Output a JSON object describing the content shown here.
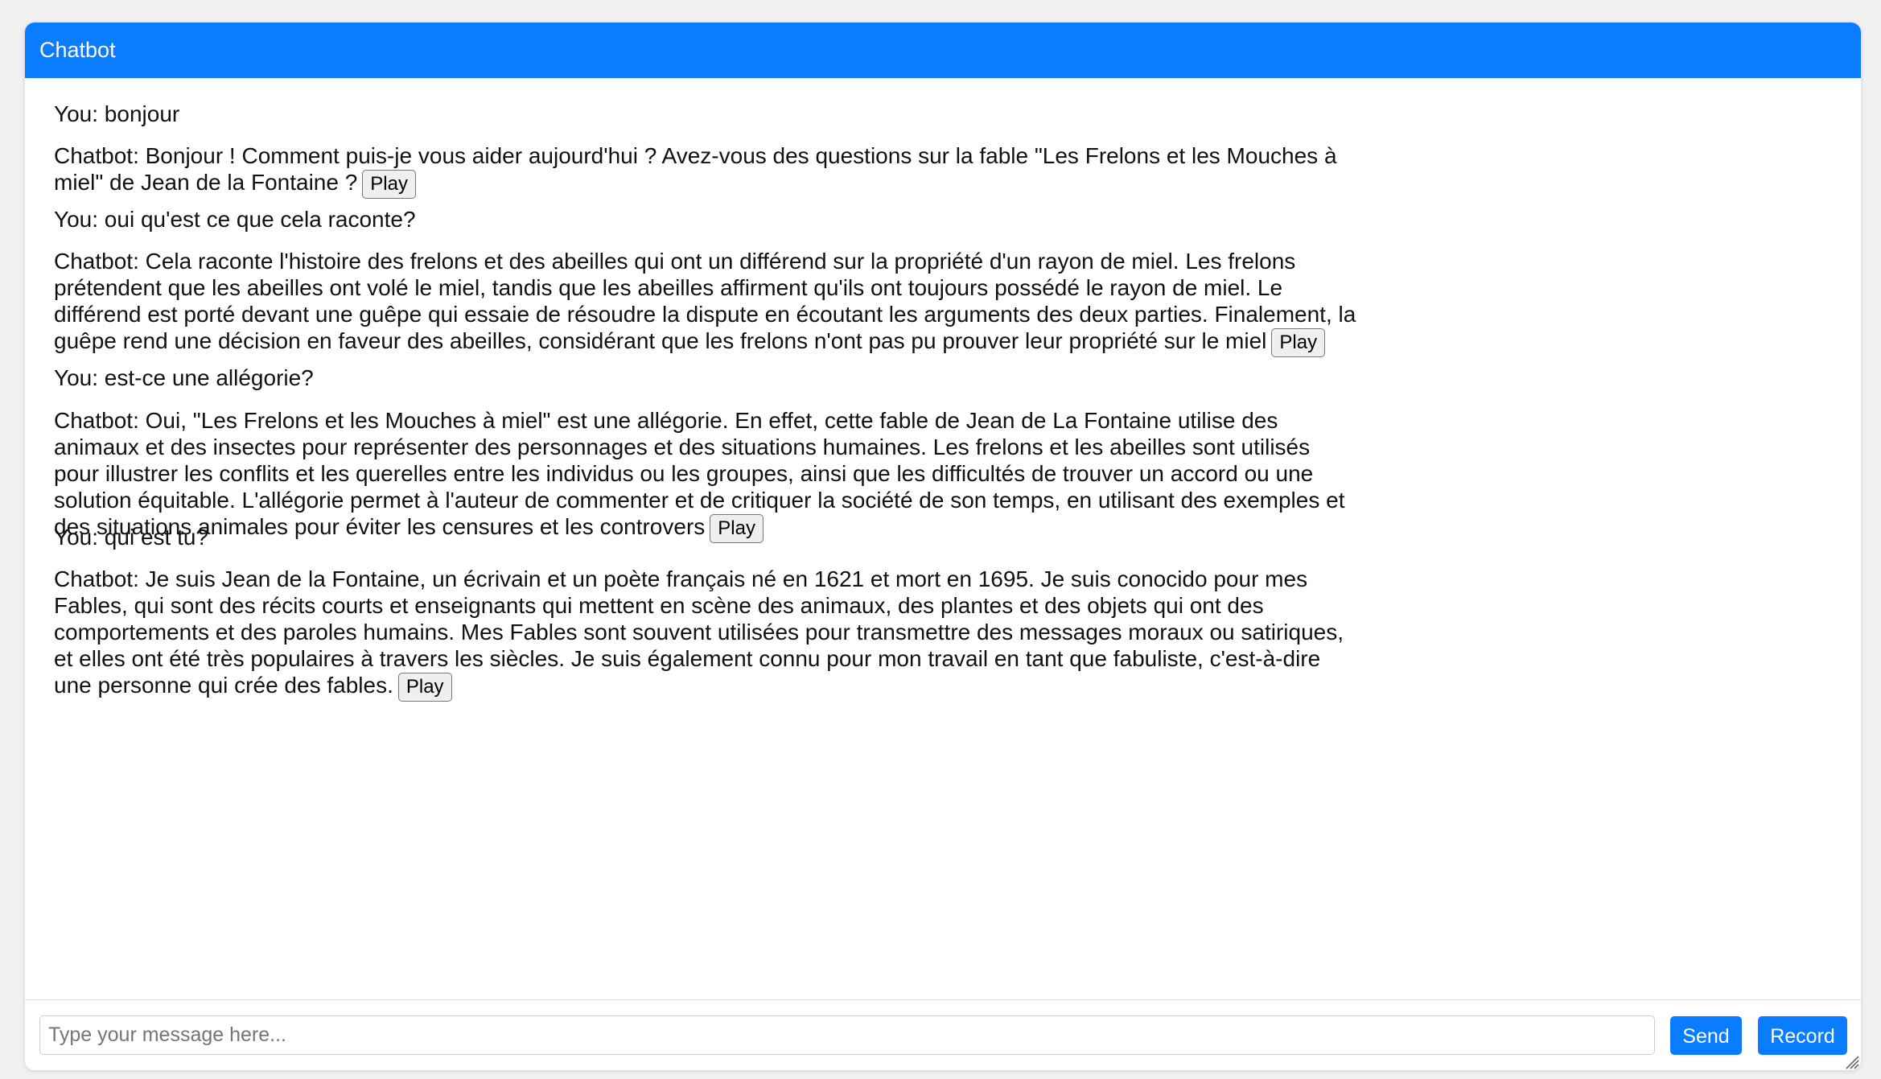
{
  "header": {
    "title": "Chatbot"
  },
  "messages": [
    {
      "text": "You: bonjour"
    },
    {
      "text": "Chatbot: Bonjour ! Comment puis-je vous aider aujourd'hui ? Avez-vous des questions sur la fable \"Les Frelons et les Mouches à miel\" de Jean de la Fontaine ?",
      "play": "Play"
    },
    {
      "text": "You: oui qu'est ce que cela raconte?"
    },
    {
      "text": "Chatbot: Cela raconte l'histoire des frelons et des abeilles qui ont un différend sur la propriété d'un rayon de miel. Les frelons prétendent que les abeilles ont volé le miel, tandis que les abeilles affirment qu'ils ont toujours possédé le rayon de miel. Le différend est porté devant une guêpe qui essaie de résoudre la dispute en écoutant les arguments des deux parties. Finalement, la guêpe rend une décision en faveur des abeilles, considérant que les frelons n'ont pas pu prouver leur propriété sur le miel",
      "play": "Play"
    },
    {
      "text": "You: est-ce une allégorie?"
    },
    {
      "text": "Chatbot: Oui, \"Les Frelons et les Mouches à miel\" est une allégorie. En effet, cette fable de Jean de La Fontaine utilise des animaux et des insectes pour représenter des personnages et des situations humaines. Les frelons et les abeilles sont utilisés pour illustrer les conflits et les querelles entre les individus ou les groupes, ainsi que les difficultés de trouver un accord ou une solution équitable. L'allégorie permet à l'auteur de commenter et de critiquer la société de son temps, en utilisant des exemples et des situations animales pour éviter les censures et les controvers",
      "play": "Play"
    },
    {
      "text": "You: qui est tu?"
    },
    {
      "text": "Chatbot: Je suis Jean de la Fontaine, un écrivain et un poète français né en 1621 et mort en 1695. Je suis conocido pour mes Fables, qui sont des récits courts et enseignants qui mettent en scène des animaux, des plantes et des objets qui ont des comportements et des paroles humains. Mes Fables sont souvent utilisées pour transmettre des messages moraux ou satiriques, et elles ont été très populaires à travers les siècles. Je suis également connu pour mon travail en tant que fabuliste, c'est-à-dire une personne qui crée des fables.",
      "play": "Play"
    }
  ],
  "input": {
    "placeholder": "Type your message here...",
    "value": ""
  },
  "buttons": {
    "send": "Send",
    "record": "Record"
  },
  "colors": {
    "accent": "#0a7cff",
    "background": "#f1f1f1"
  }
}
